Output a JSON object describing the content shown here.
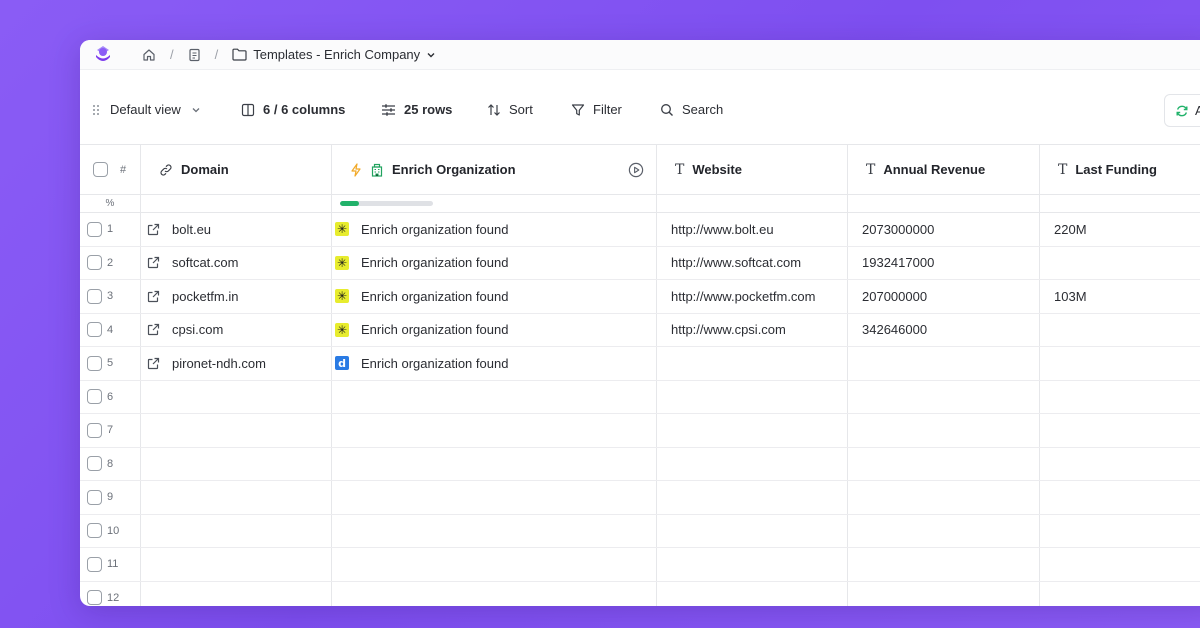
{
  "breadcrumb": {
    "separator": "/",
    "title": "Templates - Enrich Company"
  },
  "toolbar": {
    "view_label": "Default view",
    "columns_label": "6 / 6 columns",
    "rows_label": "25 rows",
    "sort_label": "Sort",
    "filter_label": "Filter",
    "search_label": "Search",
    "refresh_label": "A"
  },
  "table": {
    "rownum_header": "#",
    "percent_label": "%",
    "enrich_progress": 0.2,
    "columns": [
      "Domain",
      "Enrich Organization",
      "Website",
      "Annual Revenue",
      "Last Funding"
    ],
    "rows": [
      {
        "num": "1",
        "domain": "bolt.eu",
        "enrich": "Enrich organization found",
        "badge": "star",
        "website": "http://www.bolt.eu",
        "revenue": "2073000000",
        "funding": "220M"
      },
      {
        "num": "2",
        "domain": "softcat.com",
        "enrich": "Enrich organization found",
        "badge": "star",
        "website": "http://www.softcat.com",
        "revenue": "1932417000",
        "funding": ""
      },
      {
        "num": "3",
        "domain": "pocketfm.in",
        "enrich": "Enrich organization found",
        "badge": "star",
        "website": "http://www.pocketfm.com",
        "revenue": "207000000",
        "funding": "103M"
      },
      {
        "num": "4",
        "domain": "cpsi.com",
        "enrich": "Enrich organization found",
        "badge": "star",
        "website": "http://www.cpsi.com",
        "revenue": "342646000",
        "funding": ""
      },
      {
        "num": "5",
        "domain": "pironet-ndh.com",
        "enrich": "Enrich organization found",
        "badge": "d",
        "website": "",
        "revenue": "",
        "funding": ""
      },
      {
        "num": "6",
        "domain": "",
        "enrich": "",
        "badge": "",
        "website": "",
        "revenue": "",
        "funding": ""
      },
      {
        "num": "7",
        "domain": "",
        "enrich": "",
        "badge": "",
        "website": "",
        "revenue": "",
        "funding": ""
      },
      {
        "num": "8",
        "domain": "",
        "enrich": "",
        "badge": "",
        "website": "",
        "revenue": "",
        "funding": ""
      },
      {
        "num": "9",
        "domain": "",
        "enrich": "",
        "badge": "",
        "website": "",
        "revenue": "",
        "funding": ""
      },
      {
        "num": "10",
        "domain": "",
        "enrich": "",
        "badge": "",
        "website": "",
        "revenue": "",
        "funding": ""
      },
      {
        "num": "11",
        "domain": "",
        "enrich": "",
        "badge": "",
        "website": "",
        "revenue": "",
        "funding": ""
      },
      {
        "num": "12",
        "domain": "",
        "enrich": "",
        "badge": "",
        "website": "",
        "revenue": "",
        "funding": ""
      }
    ]
  },
  "badges": {
    "star": "✳",
    "d": "d"
  },
  "colors": {
    "background": "#8b5cf6",
    "progress_fill": "#21b26a",
    "badge_star": "#e7ec2e",
    "badge_d": "#2a7be4",
    "logo": "#7c3aed"
  }
}
